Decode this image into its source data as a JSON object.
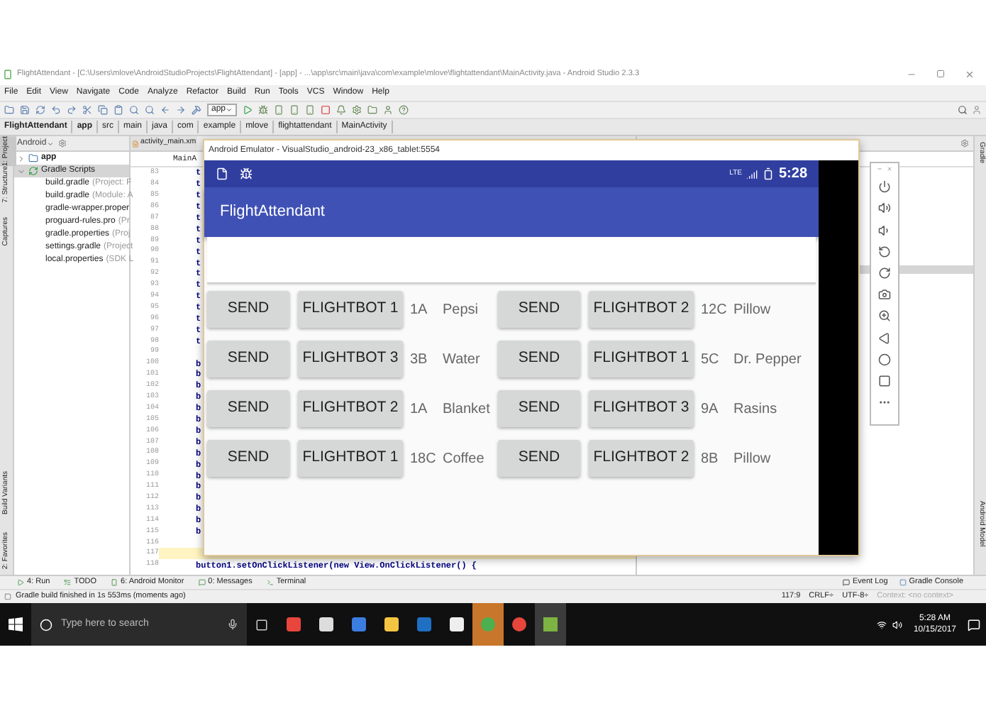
{
  "window": {
    "title": "FlightAttendant - [C:\\Users\\mlove\\AndroidStudioProjects\\FlightAttendant] - [app] - ...\\app\\src\\main\\java\\com\\example\\mlove\\flightattendant\\MainActivity.java - Android Studio 2.3.3"
  },
  "menu": [
    "File",
    "Edit",
    "View",
    "Navigate",
    "Code",
    "Analyze",
    "Refactor",
    "Build",
    "Run",
    "Tools",
    "VCS",
    "Window",
    "Help"
  ],
  "toolbar": {
    "run_config": "app"
  },
  "breadcrumbs": [
    "FlightAttendant",
    "app",
    "src",
    "main",
    "java",
    "com",
    "example",
    "mlove",
    "flightattendant",
    "MainActivity"
  ],
  "left_tool_tabs": [
    {
      "label": "1: Project",
      "selected": true
    },
    {
      "label": "7: Structure",
      "selected": false
    },
    {
      "label": "Captures",
      "selected": false
    },
    {
      "label": "Build Variants",
      "selected": false
    },
    {
      "label": "2: Favorites",
      "selected": false
    }
  ],
  "project_panel": {
    "view": "Android",
    "tree": [
      {
        "label": "app",
        "expanded": false,
        "selected": false
      },
      {
        "label": "Gradle Scripts",
        "expanded": true,
        "selected": true,
        "children": [
          {
            "label": "build.gradle",
            "hint": "(Project: F"
          },
          {
            "label": "build.gradle",
            "hint": "(Module: A"
          },
          {
            "label": "gradle-wrapper.proper"
          },
          {
            "label": "proguard-rules.pro",
            "hint": "(Pr"
          },
          {
            "label": "gradle.properties",
            "hint": "(Proj"
          },
          {
            "label": "settings.gradle",
            "hint": "(Project"
          },
          {
            "label": "local.properties",
            "hint": "(SDK L"
          }
        ]
      }
    ]
  },
  "editor": {
    "tabs": [
      {
        "label": "activity_main.xm",
        "selected": false
      }
    ],
    "breadcrumb": "MainA",
    "lines": [
      {
        "number": "83",
        "code": "t",
        "current": false
      },
      {
        "number": "84",
        "code": "t",
        "current": false
      },
      {
        "number": "85",
        "code": "t",
        "current": false
      },
      {
        "number": "86",
        "code": "t",
        "current": false
      },
      {
        "number": "87",
        "code": "t",
        "current": false
      },
      {
        "number": "88",
        "code": "t",
        "current": false
      },
      {
        "number": "89",
        "code": "t",
        "current": false
      },
      {
        "number": "90",
        "code": "t",
        "current": false
      },
      {
        "number": "91",
        "code": "t",
        "current": false
      },
      {
        "number": "92",
        "code": "t",
        "current": false
      },
      {
        "number": "93",
        "code": "t",
        "current": false
      },
      {
        "number": "94",
        "code": "t",
        "current": false
      },
      {
        "number": "95",
        "code": "t",
        "current": false
      },
      {
        "number": "96",
        "code": "t",
        "current": false
      },
      {
        "number": "97",
        "code": "t",
        "current": false
      },
      {
        "number": "98",
        "code": "t",
        "current": false
      },
      {
        "number": "99",
        "current": false
      },
      {
        "number": "100",
        "code": "b",
        "current": false
      },
      {
        "number": "101",
        "code": "b",
        "current": false
      },
      {
        "number": "102",
        "code": "b",
        "current": false
      },
      {
        "number": "103",
        "code": "b",
        "current": false
      },
      {
        "number": "104",
        "code": "b",
        "current": false
      },
      {
        "number": "105",
        "code": "b",
        "current": false
      },
      {
        "number": "106",
        "code": "b",
        "current": false
      },
      {
        "number": "107",
        "code": "b",
        "current": false
      },
      {
        "number": "108",
        "code": "b",
        "current": false
      },
      {
        "number": "109",
        "code": "b",
        "current": false
      },
      {
        "number": "110",
        "code": "b",
        "current": false
      },
      {
        "number": "111",
        "code": "b",
        "current": false
      },
      {
        "number": "112",
        "code": "b",
        "current": false
      },
      {
        "number": "113",
        "code": "b",
        "current": false
      },
      {
        "number": "114",
        "code": "b",
        "current": false
      },
      {
        "number": "115",
        "code": "b",
        "current": false
      },
      {
        "number": "116",
        "current": false
      },
      {
        "number": "117",
        "current": true
      },
      {
        "number": "118",
        "code": "button1.setOnClickListener(new View.OnClickListener() {",
        "current": false
      }
    ]
  },
  "emulator": {
    "title": "Android Emulator - VisualStudio_android-23_x86_tablet:5554",
    "network": "LTE",
    "time": "5:28",
    "app_title": "FlightAttendant",
    "rows": [
      {
        "groups": [
          {
            "send": "SEND",
            "bot": "FLIGHTBOT 1",
            "seat": "1A",
            "item": "Pepsi"
          },
          {
            "send": "SEND",
            "bot": "FLIGHTBOT 2",
            "seat": "12C",
            "item": "Pillow"
          }
        ]
      },
      {
        "groups": [
          {
            "send": "SEND",
            "bot": "FLIGHTBOT 3",
            "seat": "3B",
            "item": "Water"
          },
          {
            "send": "SEND",
            "bot": "FLIGHTBOT 1",
            "seat": "5C",
            "item": "Dr. Pepper"
          }
        ]
      },
      {
        "groups": [
          {
            "send": "SEND",
            "bot": "FLIGHTBOT 2",
            "seat": "1A",
            "item": "Blanket"
          },
          {
            "send": "SEND",
            "bot": "FLIGHTBOT 3",
            "seat": "9A",
            "item": "Rasins"
          }
        ]
      },
      {
        "groups": [
          {
            "send": "SEND",
            "bot": "FLIGHTBOT 1",
            "seat": "18C",
            "item": "Coffee"
          },
          {
            "send": "SEND",
            "bot": "FLIGHTBOT 2",
            "seat": "8B",
            "item": "Pillow"
          }
        ]
      }
    ]
  },
  "right_tool_tabs": [
    "Gradle",
    "Android Model"
  ],
  "bottom_tool_tabs": [
    "4: Run",
    "TODO",
    "6: Android Monitor",
    "0: Messages",
    "Terminal"
  ],
  "bottom_right_tabs": [
    "Event Log",
    "Gradle Console"
  ],
  "status_bar": {
    "message": "Gradle build finished in 1s 553ms (moments ago)",
    "position": "117:9",
    "line_separator": "CRLF÷",
    "encoding": "UTF-8÷",
    "context": "Context: <no context>"
  },
  "taskbar": {
    "search_placeholder": "Type here to search",
    "time": "5:28 AM",
    "date": "10/15/2017"
  }
}
